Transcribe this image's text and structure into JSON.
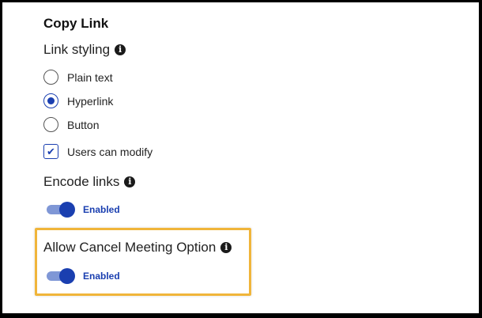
{
  "title": "Copy Link",
  "link_styling": {
    "label": "Link styling",
    "options": [
      {
        "label": "Plain text",
        "checked": false
      },
      {
        "label": "Hyperlink",
        "checked": true
      },
      {
        "label": "Button",
        "checked": false
      }
    ],
    "users_can_modify": {
      "label": "Users can modify",
      "checked": true
    }
  },
  "encode_links": {
    "label": "Encode links",
    "toggle_label": "Enabled",
    "enabled": true
  },
  "allow_cancel": {
    "label": "Allow Cancel Meeting Option",
    "toggle_label": "Enabled",
    "enabled": true
  },
  "colors": {
    "accent": "#1a3fb0",
    "highlight": "#f0b53a"
  }
}
